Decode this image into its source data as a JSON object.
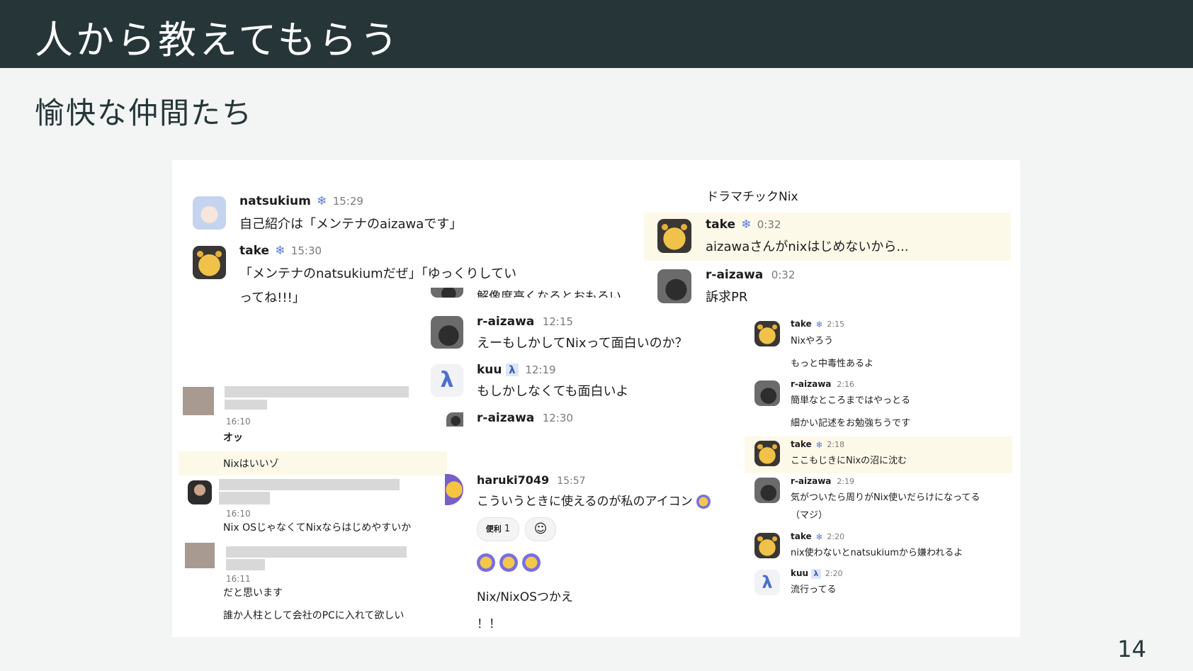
{
  "slide": {
    "title": "人から教えてもらう",
    "subtitle": "愉快な仲間たち",
    "page_number": "14"
  },
  "badges": {
    "snowflake": "❄",
    "lambda": "λ",
    "emoji_face": "☺"
  },
  "left": {
    "m1": {
      "name": "natsukium",
      "time": "15:29",
      "text": "自己紹介は「メンテナのaizawaです」"
    },
    "m2": {
      "name": "take",
      "time": "15:30",
      "text1": "「メンテナのnatsukiumだぜ」「ゆっくりしてい",
      "text2": "ってね!!!」"
    },
    "b1": {
      "time": "16:10",
      "text1": "オッ",
      "text2": "Nixはいいゾ"
    },
    "b2": {
      "time": "16:10",
      "text": "Nix OSじゃなくてNixならはじめやすいか"
    },
    "b3": {
      "time": "16:11",
      "text1": "だと思います",
      "text2": "誰か人柱として会社のPCに入れて欲しい"
    }
  },
  "middle": {
    "cut_text": "解像度高くなるとおもろい",
    "m1": {
      "name": "r-aizawa",
      "time": "12:15",
      "text": "えーもしかしてNixって面白いのか？"
    },
    "m2": {
      "name": "kuu",
      "time": "12:19",
      "text": "もしかしなくても面白いよ"
    },
    "m3": {
      "name": "r-aizawa",
      "time": "12:30"
    },
    "m4": {
      "name": "haruki7049",
      "time": "15:57",
      "text": "こういうときに使えるのが私のアイコン"
    },
    "reaction_label": "便利",
    "reaction_count": "1",
    "footer1": "Nix/NixOSつかえ",
    "footer2": "！！"
  },
  "right_top": {
    "header": "ドラマチックNix",
    "m1": {
      "name": "take",
      "time": "0:32",
      "text": "aizawaさんがnixはじめないから..."
    },
    "m2": {
      "name": "r-aizawa",
      "time": "0:32",
      "text": "訴求PR"
    }
  },
  "right": {
    "m1": {
      "name": "take",
      "time": "2:15",
      "text1": "Nixやろう",
      "text2": "もっと中毒性あるよ"
    },
    "m2": {
      "name": "r-aizawa",
      "time": "2:16",
      "text1": "簡単なところまではやっとる",
      "text2": "細かい記述をお勉強ちうです"
    },
    "m3": {
      "name": "take",
      "time": "2:18",
      "text": "ここもじきにNixの沼に沈む"
    },
    "m4": {
      "name": "r-aizawa",
      "time": "2:19",
      "text1": "気がついたら周りがNix使いだらけになってる",
      "text2": "（マジ）"
    },
    "m5": {
      "name": "take",
      "time": "2:20",
      "text": "nix使わないとnatsukiumから嫌われるよ"
    },
    "m6": {
      "name": "kuu",
      "time": "2:20",
      "text": "流行ってる"
    }
  }
}
